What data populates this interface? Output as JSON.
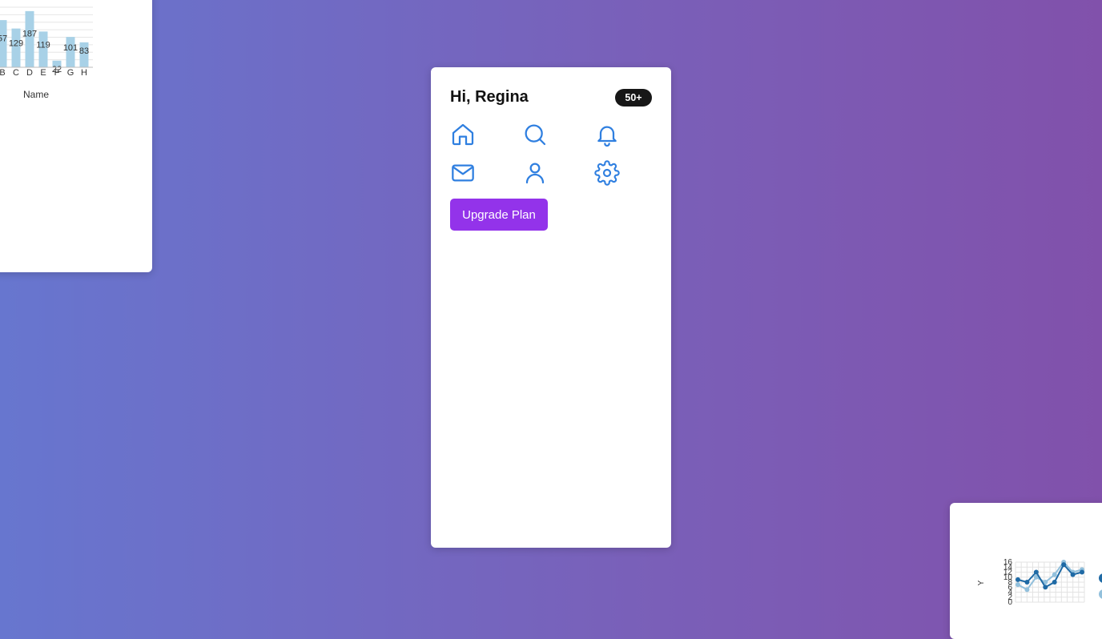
{
  "main": {
    "greeting": "Hi, Regina",
    "badge": "50+",
    "icons": [
      "home-icon",
      "search-icon",
      "bell-icon",
      "mail-icon",
      "user-icon",
      "settings-icon"
    ],
    "upgrade_label": "Upgrade Plan",
    "accent": "#2f7fe0",
    "button_color": "#9333ea"
  },
  "chart_data": [
    {
      "type": "bar",
      "categories": [
        "B",
        "C",
        "D",
        "E",
        "F",
        "G",
        "H"
      ],
      "values": [
        157,
        129,
        187,
        119,
        22,
        101,
        83
      ],
      "value_labels": [
        "57",
        "129",
        "187",
        "119",
        "22",
        "101",
        "83"
      ],
      "xlabel": "Name",
      "ylabel": "",
      "ylim": [
        0,
        200
      ],
      "grid": true,
      "color": "#a8d1e7"
    },
    {
      "type": "line",
      "ylabel": "Y",
      "y_ticks": [
        "0",
        "2",
        "4",
        "6",
        "8",
        "10",
        "12",
        "14",
        "16"
      ],
      "ylim": [
        0,
        16
      ],
      "grid": true,
      "series": [
        {
          "color": "#1f6aa5",
          "values": [
            9,
            8,
            12,
            6,
            8,
            15,
            11,
            12
          ]
        },
        {
          "color": "#92c0dc",
          "values": [
            7,
            5,
            10,
            8,
            11,
            16,
            12,
            13
          ]
        }
      ]
    }
  ]
}
